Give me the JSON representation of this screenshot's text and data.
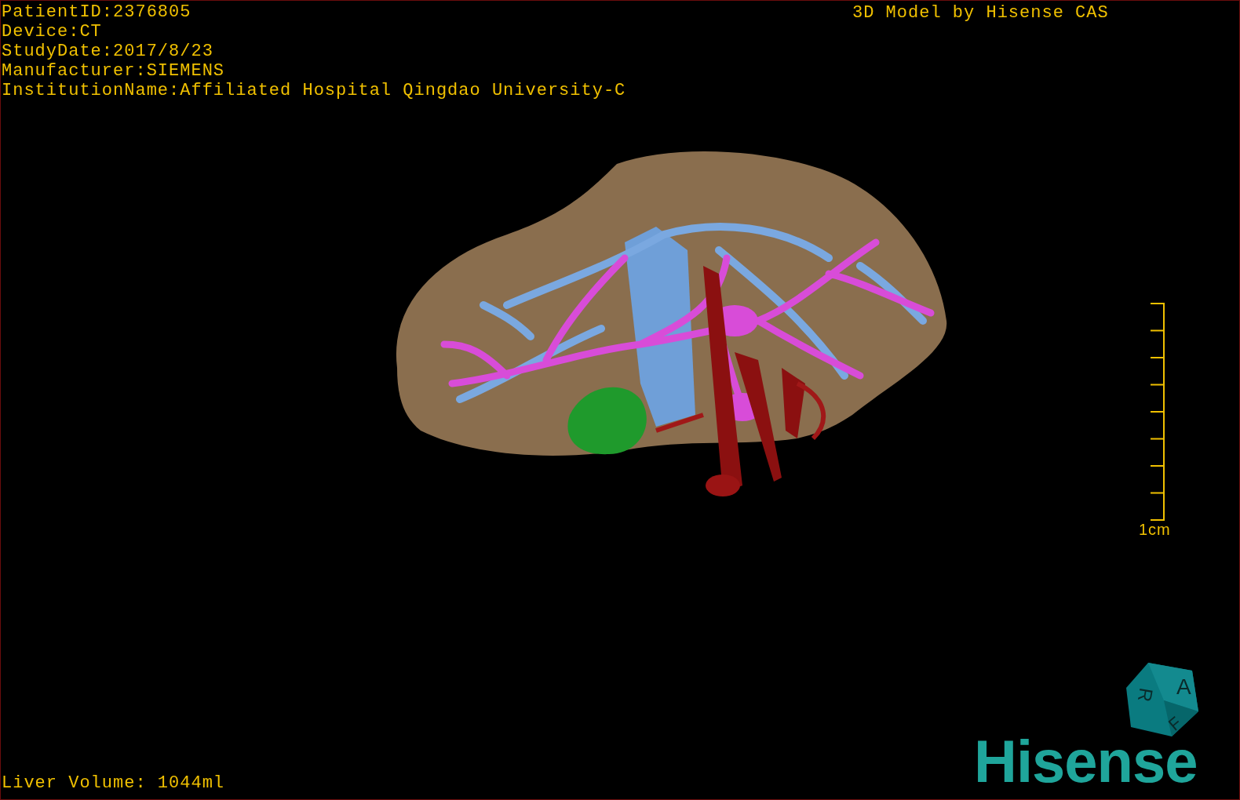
{
  "study_info": [
    "PatientID:2376805",
    "Device:CT",
    "StudyDate:2017/8/23",
    "Manufacturer:SIEMENS",
    "InstitutionName:Affiliated Hospital Qingdao University-C"
  ],
  "header_title": "3D Model by Hisense CAS",
  "scale_bar": {
    "label": "1cm"
  },
  "orientation_cube": {
    "faces": [
      "A",
      "R",
      "F"
    ]
  },
  "logo": "Hisense",
  "liver_volume": "Liver Volume: 1044ml"
}
